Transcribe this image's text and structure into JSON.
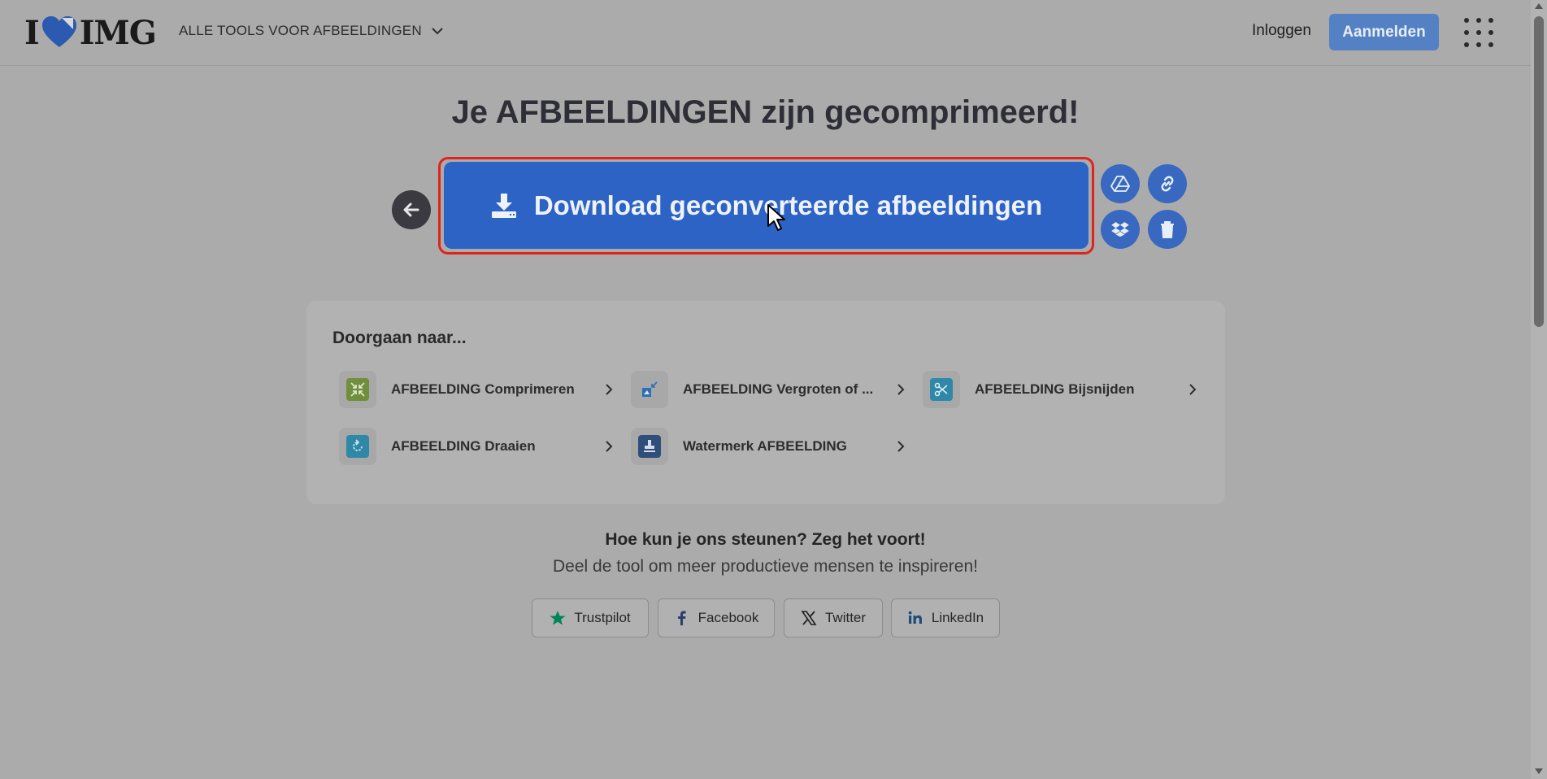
{
  "header": {
    "logo_text_left": "I",
    "logo_text_right": "IMG",
    "tools_menu_label": "ALLE TOOLS VOOR AFBEELDINGEN",
    "login_label": "Inloggen",
    "signup_label": "Aanmelden"
  },
  "main": {
    "title": "Je AFBEELDINGEN zijn gecomprimeerd!",
    "download_label": "Download geconverteerde afbeeldingen",
    "side_buttons": [
      "google-drive-icon",
      "link-icon",
      "dropbox-icon",
      "trash-icon"
    ]
  },
  "continue": {
    "title": "Doorgaan naar...",
    "tools": [
      {
        "label": "AFBEELDING Comprimeren",
        "icon": "compress-icon",
        "color": "#6f8f3d"
      },
      {
        "label": "AFBEELDING Vergroten of ...",
        "icon": "resize-icon",
        "color": "#2d6fb3"
      },
      {
        "label": "AFBEELDING Bijsnijden",
        "icon": "crop-icon",
        "color": "#2f88a8"
      },
      {
        "label": "AFBEELDING Draaien",
        "icon": "rotate-icon",
        "color": "#2f88a8"
      },
      {
        "label": "Watermerk AFBEELDING",
        "icon": "stamp-icon",
        "color": "#2f4e7a"
      }
    ]
  },
  "support": {
    "heading": "Hoe kun je ons steunen? Zeg het voort!",
    "subheading": "Deel de tool om meer productieve mensen te inspireren!",
    "buttons": [
      {
        "label": "Trustpilot",
        "icon": "star-icon",
        "color": "#00855a"
      },
      {
        "label": "Facebook",
        "icon": "facebook-icon",
        "color": "#2f3e6a"
      },
      {
        "label": "Twitter",
        "icon": "x-icon",
        "color": "#1f1f1f"
      },
      {
        "label": "LinkedIn",
        "icon": "linkedin-icon",
        "color": "#1f4d7a"
      }
    ]
  },
  "colors": {
    "overlay_bg": "#ababab",
    "primary": "#2d63c4",
    "highlight_outline": "#e2231a"
  }
}
